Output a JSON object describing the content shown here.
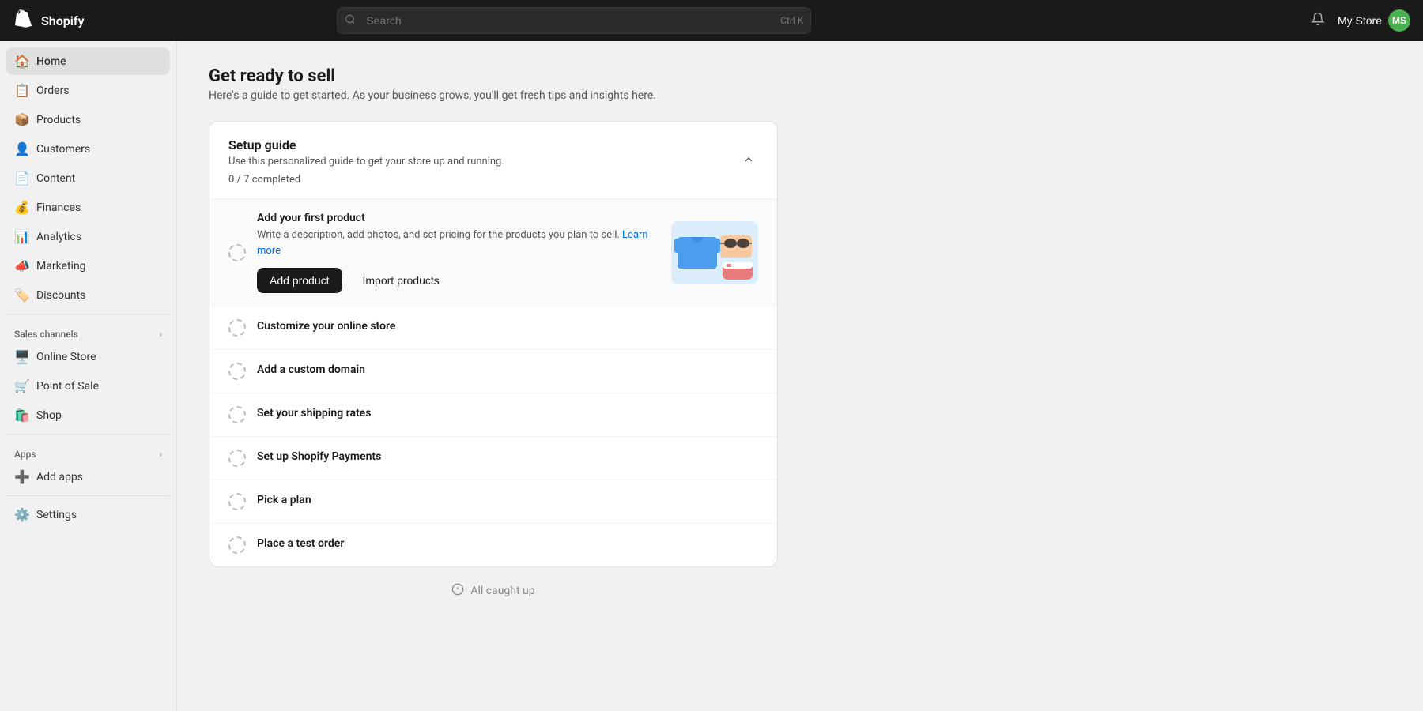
{
  "topbar": {
    "logo_text": "Shopify",
    "search_placeholder": "Search",
    "search_shortcut": "Ctrl K",
    "store_name": "My Store",
    "avatar_initials": "MS",
    "avatar_color": "#4CAF50"
  },
  "sidebar": {
    "nav_items": [
      {
        "id": "home",
        "label": "Home",
        "icon": "🏠",
        "active": true
      },
      {
        "id": "orders",
        "label": "Orders",
        "icon": "📋",
        "active": false
      },
      {
        "id": "products",
        "label": "Products",
        "icon": "📦",
        "active": false
      },
      {
        "id": "customers",
        "label": "Customers",
        "icon": "👤",
        "active": false
      },
      {
        "id": "content",
        "label": "Content",
        "icon": "📄",
        "active": false
      },
      {
        "id": "finances",
        "label": "Finances",
        "icon": "💰",
        "active": false
      },
      {
        "id": "analytics",
        "label": "Analytics",
        "icon": "📊",
        "active": false
      },
      {
        "id": "marketing",
        "label": "Marketing",
        "icon": "📣",
        "active": false
      },
      {
        "id": "discounts",
        "label": "Discounts",
        "icon": "🏷️",
        "active": false
      }
    ],
    "sales_channels_label": "Sales channels",
    "sales_channels": [
      {
        "id": "online-store",
        "label": "Online Store",
        "icon": "🖥️"
      },
      {
        "id": "point-of-sale",
        "label": "Point of Sale",
        "icon": "🛒"
      },
      {
        "id": "shop",
        "label": "Shop",
        "icon": "🛍️"
      }
    ],
    "apps_label": "Apps",
    "apps_items": [
      {
        "id": "add-apps",
        "label": "Add apps",
        "icon": "➕"
      }
    ],
    "settings_label": "Settings"
  },
  "page": {
    "title": "Get ready to sell",
    "subtitle": "Here's a guide to get started. As your business grows, you'll get fresh tips and insights here.",
    "setup_guide": {
      "title": "Setup guide",
      "subtitle": "Use this personalized guide to get your store up and running.",
      "completed_count": 0,
      "total_count": 7,
      "completed_label": "completed",
      "items": [
        {
          "id": "add-product",
          "title": "Add your first product",
          "desc": "Write a description, add photos, and set pricing for the products you plan to sell.",
          "link_text": "Learn more",
          "expanded": true,
          "primary_action": "Add product",
          "secondary_action": "Import products"
        },
        {
          "id": "customize-store",
          "title": "Customize your online store",
          "expanded": false
        },
        {
          "id": "custom-domain",
          "title": "Add a custom domain",
          "expanded": false
        },
        {
          "id": "shipping-rates",
          "title": "Set your shipping rates",
          "expanded": false
        },
        {
          "id": "shopify-payments",
          "title": "Set up Shopify Payments",
          "expanded": false
        },
        {
          "id": "pick-plan",
          "title": "Pick a plan",
          "expanded": false
        },
        {
          "id": "test-order",
          "title": "Place a test order",
          "expanded": false
        }
      ]
    },
    "all_caught_up": "All caught up"
  }
}
